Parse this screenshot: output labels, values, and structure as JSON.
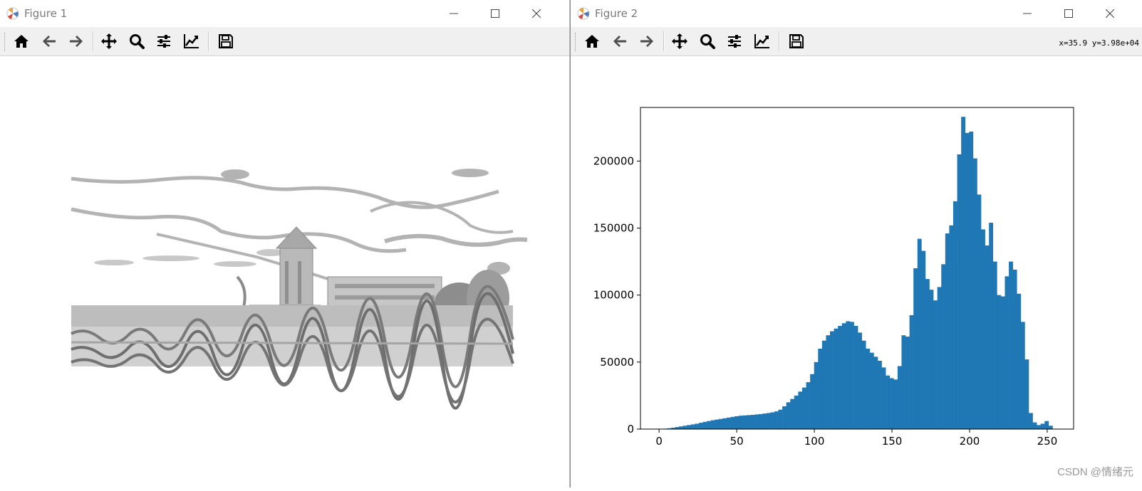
{
  "figure1": {
    "title": "Figure 1",
    "image_icon": "grayscale-photo-landscape-icon"
  },
  "figure2": {
    "title": "Figure 2",
    "coords": "x=35.9 y=3.98e+04"
  },
  "toolbar": [
    "home-icon",
    "back-arrow-icon",
    "forward-arrow-icon",
    "pan-icon",
    "zoom-icon",
    "configure-subplots-icon",
    "edit-axis-icon",
    "save-icon"
  ],
  "watermark": "CSDN @情绪元",
  "colors": {
    "bar": "#1f77b4",
    "axis": "#000000"
  },
  "chart_data": {
    "type": "bar",
    "xlim": [
      -12,
      267
    ],
    "ylim": [
      0,
      240000
    ],
    "xticks": [
      0,
      50,
      100,
      150,
      200,
      250
    ],
    "yticks": [
      0,
      50000,
      100000,
      150000,
      200000
    ],
    "bin_width": 2.56,
    "bin_start": 0,
    "values": [
      0,
      300,
      600,
      1000,
      1500,
      2000,
      2500,
      3000,
      3500,
      4000,
      4700,
      5400,
      6000,
      6600,
      7100,
      7600,
      8100,
      8600,
      9100,
      9600,
      10000,
      10200,
      10400,
      10600,
      10900,
      11200,
      11600,
      12000,
      12500,
      13200,
      14500,
      17000,
      20000,
      22500,
      25000,
      28000,
      31000,
      35000,
      41000,
      50000,
      60000,
      66000,
      70000,
      73000,
      75000,
      77000,
      79000,
      80500,
      80000,
      77000,
      72000,
      66000,
      60000,
      57000,
      54000,
      51000,
      46000,
      40000,
      38000,
      37000,
      47000,
      70000,
      69000,
      85000,
      120000,
      142000,
      133000,
      112000,
      104000,
      96000,
      106000,
      123000,
      146000,
      152000,
      170000,
      205000,
      233000,
      221000,
      222000,
      202000,
      175000,
      149000,
      137000,
      154000,
      125000,
      100000,
      99000,
      114000,
      125000,
      119000,
      101000,
      80000,
      52000,
      12000,
      5000,
      3000,
      4000,
      6000,
      2500
    ]
  }
}
